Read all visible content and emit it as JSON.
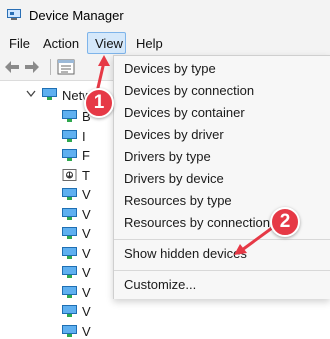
{
  "window": {
    "title": "Device Manager"
  },
  "menubar": {
    "items": [
      "File",
      "Action",
      "View",
      "Help"
    ]
  },
  "tree": {
    "root_label": "Netw",
    "child_letters": [
      "B",
      "I",
      "F",
      "T",
      "V",
      "V",
      "V",
      "V",
      "V",
      "V",
      "V",
      "V"
    ]
  },
  "view_menu": {
    "items": [
      "Devices by type",
      "Devices by connection",
      "Devices by container",
      "Devices by driver",
      "Drivers by type",
      "Drivers by device",
      "Resources by type",
      "Resources by connection",
      "Show hidden devices",
      "Customize..."
    ]
  },
  "callouts": {
    "step1": "1",
    "step2": "2"
  },
  "colors": {
    "accent": "#e63946",
    "menu_highlight": "#d5e8fa",
    "icon_blue": "#1f7fd1",
    "icon_green": "#2fa84f"
  }
}
